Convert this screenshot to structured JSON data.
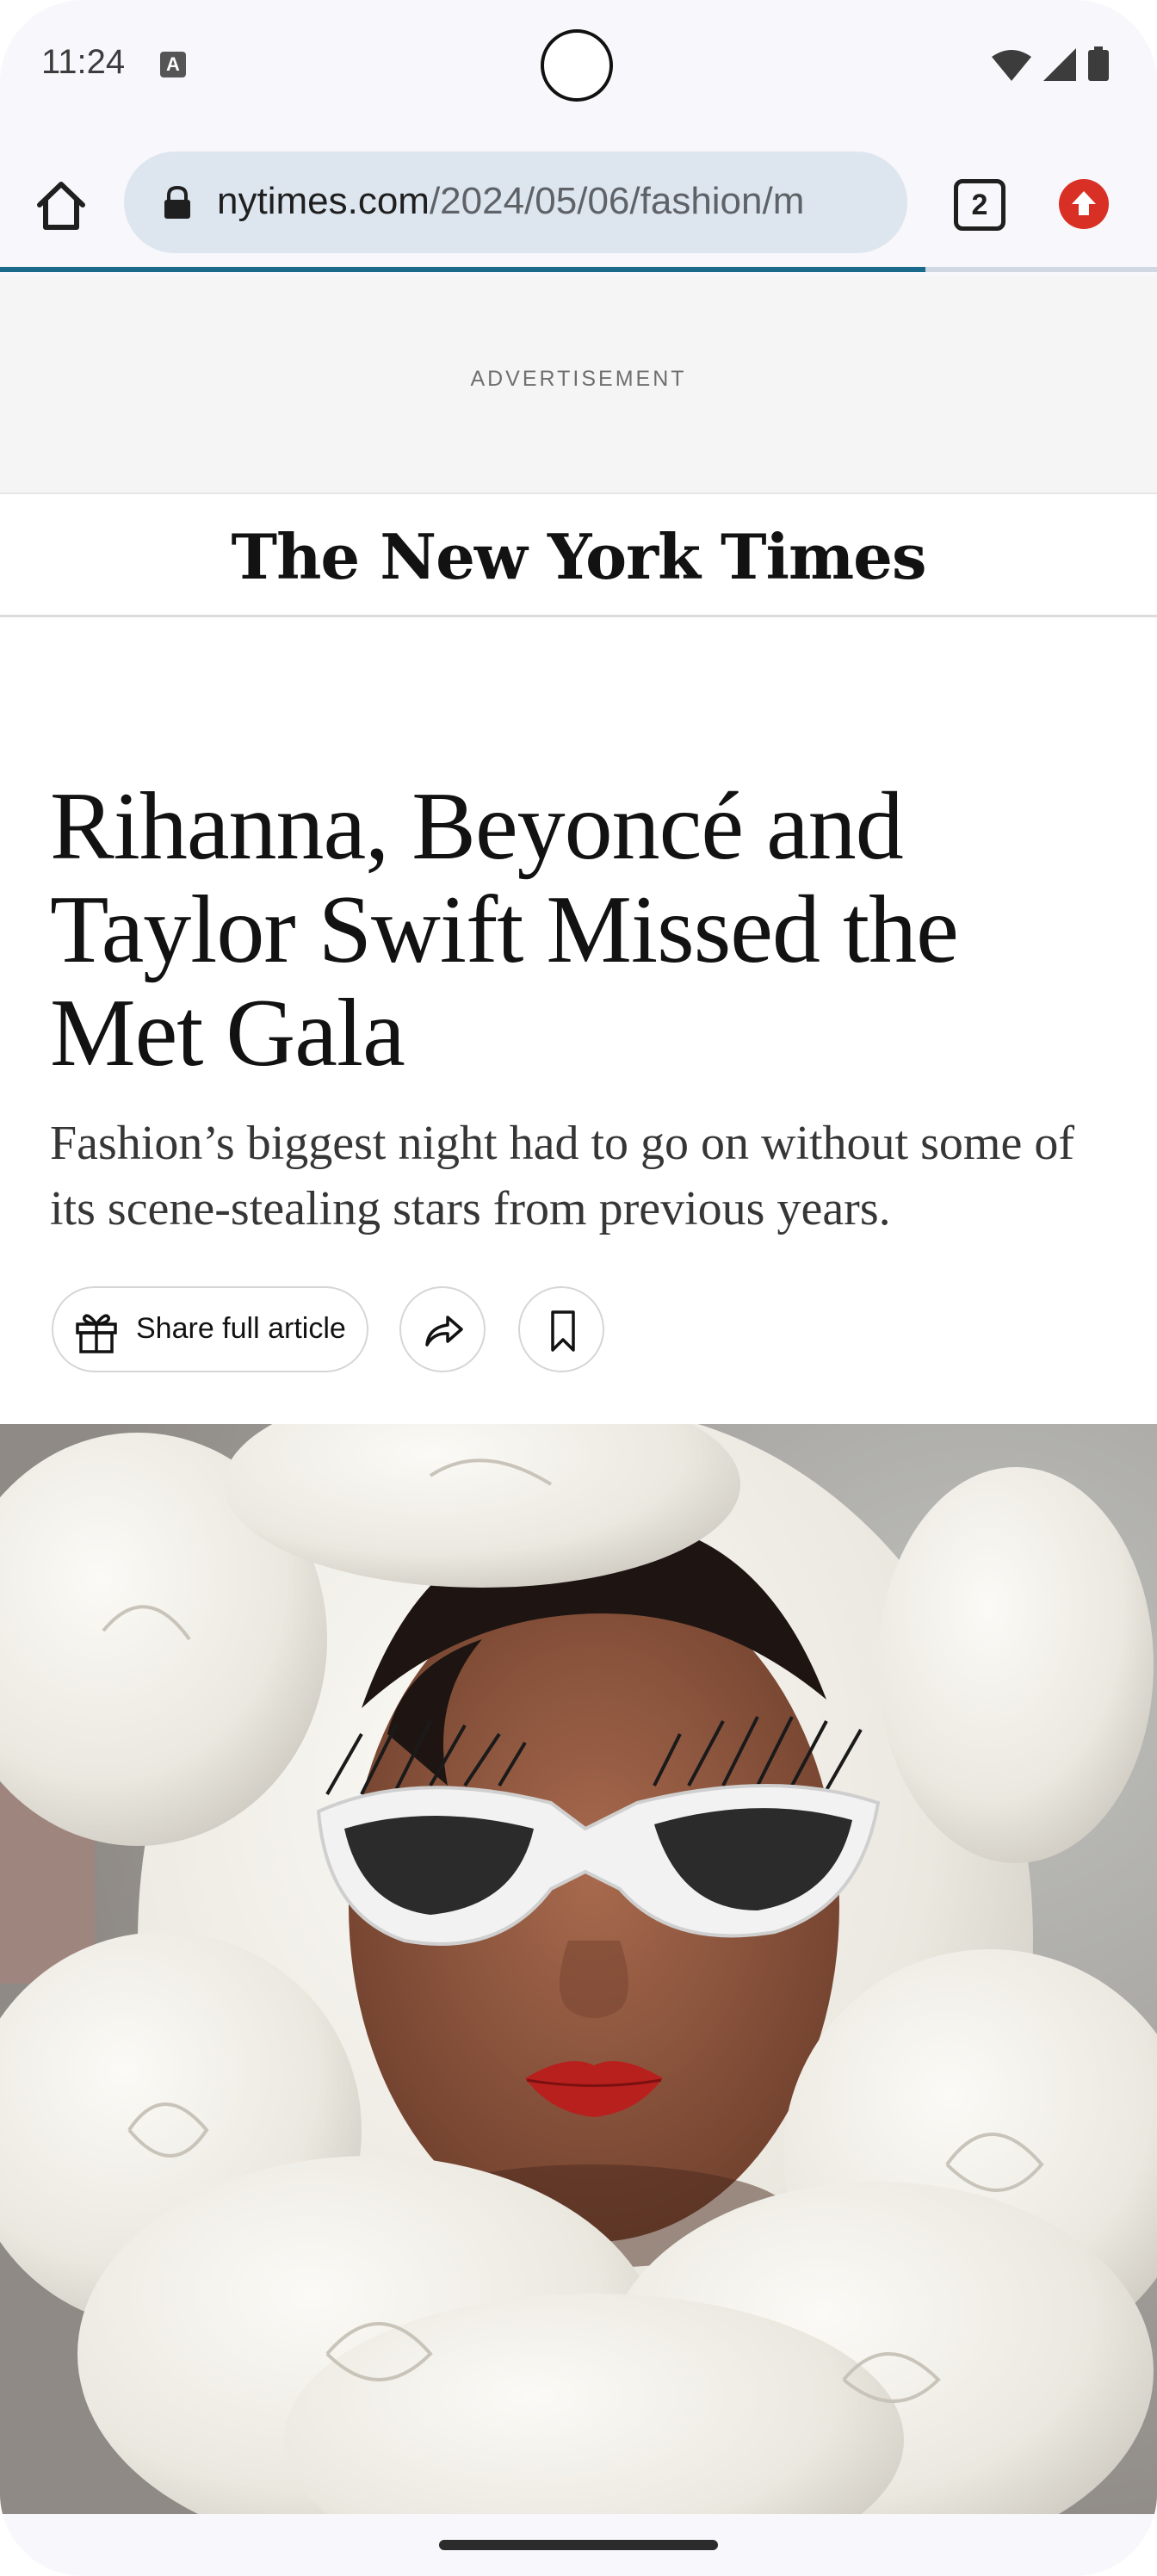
{
  "status_bar": {
    "time": "11:24",
    "a_icon": "A"
  },
  "browser": {
    "url_domain": "nytimes.com",
    "url_path": "/2024/05/06/fashion/m",
    "tab_count": "2",
    "load_progress_fraction": 0.8
  },
  "ad": {
    "label": "ADVERTISEMENT"
  },
  "masthead": {
    "logo": "The New York Times"
  },
  "article": {
    "headline": "Rihanna, Beyoncé and Taylor Swift Missed the Met Gala",
    "summary": "Fashion’s biggest night had to go on without some of its scene-stealing stars from previous years.",
    "share_full_label": "Share full article"
  },
  "icons": {
    "home": "home-icon",
    "lock": "lock-icon",
    "tabs": "tab-switcher-icon",
    "update": "update-icon",
    "gift": "gift-icon",
    "share": "share-icon",
    "bookmark": "bookmark-icon"
  },
  "colors": {
    "update_badge": "#d93025",
    "progress": "#1a6a8c",
    "url_bar_bg": "#dde6ef"
  }
}
